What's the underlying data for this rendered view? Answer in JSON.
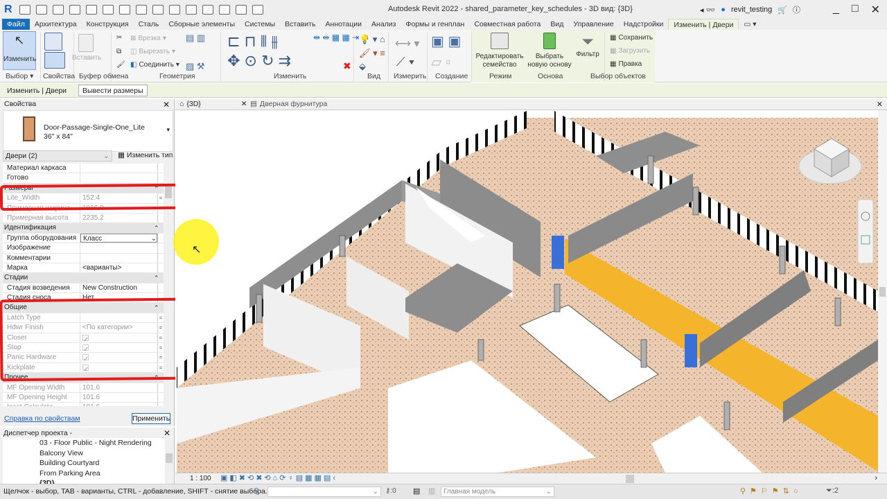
{
  "titlebar": {
    "title": "Autodesk Revit 2022 - shared_parameter_key_schedules - 3D вид: {3D}",
    "user": "revit_testing",
    "app_logo": "R"
  },
  "tabs": [
    "Файл",
    "Архитектура",
    "Конструкция",
    "Сталь",
    "Сборные элементы",
    "Системы",
    "Вставить",
    "Аннотации",
    "Анализ",
    "Формы и генплан",
    "Совместная работа",
    "Вид",
    "Управление",
    "Надстройки",
    "Изменить | Двери"
  ],
  "active_tab": "Изменить | Двери",
  "ribbon": {
    "modify": "Изменить",
    "paste": "Вставить",
    "cut_geom": "Врезка",
    "cut": "Вырезать",
    "join": "Соединить",
    "edit_family": "Редактировать семейство",
    "pick_host": "Выбрать новую основу",
    "filter": "Фильтр",
    "save": "Сохранить",
    "load": "Загрузить",
    "edit": "Правка",
    "panels": [
      "Выбор",
      "Свойства",
      "Буфер обмена",
      "Геометрия",
      "Изменить",
      "Вид",
      "Измерить",
      "Создание",
      "Режим",
      "Основа",
      "Выбор объектов"
    ]
  },
  "context_bar": {
    "label": "Изменить | Двери",
    "button": "Вывести размеры"
  },
  "properties": {
    "title": "Свойства",
    "type_name": "Door-Passage-Single-One_Lite",
    "type_size": "36\" x 84\"",
    "category": "Двери (2)",
    "edit_type": "Изменить тип",
    "rows": [
      {
        "k": "Материал каркаса",
        "v": ""
      },
      {
        "k": "Готово",
        "v": ""
      },
      {
        "group": "Размеры"
      },
      {
        "k": "Lite_Width",
        "v": "152.4",
        "dis": true,
        "eq": true
      },
      {
        "k": "Примерная ширина",
        "v": "1016.0",
        "dis": true
      },
      {
        "k": "Примерная высота",
        "v": "2235.2",
        "dis": true
      },
      {
        "group": "Идентификация"
      },
      {
        "k": "Группа оборудования",
        "v": "Класс",
        "select": true
      },
      {
        "k": "Изображение",
        "v": ""
      },
      {
        "k": "Комментарии",
        "v": ""
      },
      {
        "k": "Марка",
        "v": "<варианты>"
      },
      {
        "group": "Стадии"
      },
      {
        "k": "Стадия возведения",
        "v": "New Construction"
      },
      {
        "k": "Стадия сноса",
        "v": "Нет"
      },
      {
        "group": "Общие"
      },
      {
        "k": "Latch Type",
        "v": "",
        "dis": true,
        "eq": true
      },
      {
        "k": "Hdwr Finish",
        "v": "<По категории>",
        "dis": true,
        "eq": true
      },
      {
        "k": "Closer",
        "v": "",
        "check": true,
        "dis": true,
        "eq": true
      },
      {
        "k": "Stop",
        "v": "",
        "check": true,
        "dis": true,
        "eq": true
      },
      {
        "k": "Panic Hardware",
        "v": "",
        "check": true,
        "dis": true,
        "eq": true
      },
      {
        "k": "Kickplate",
        "v": "",
        "check": true,
        "dis": true,
        "eq": true
      },
      {
        "group": "Прочее"
      },
      {
        "k": "MF Opening Width",
        "v": "101.6",
        "dis": true
      },
      {
        "k": "MF Opening Height",
        "v": "101.6",
        "dis": true
      },
      {
        "k": "Inset Calculate",
        "v": "101.6",
        "dis": true
      }
    ],
    "help": "Справка по свойствам",
    "apply": "Применить"
  },
  "browser": {
    "title": "Диспетчер проекта - shared_parameter_key_sched...",
    "items": [
      "03 - Floor Public - Night Rendering",
      "Balcony View",
      "Building Courtyard",
      "From Parking Area",
      "{3D}"
    ]
  },
  "view_tabs": [
    {
      "label": "{3D}",
      "active": true
    },
    {
      "label": "Дверная фурнитура",
      "active": false
    }
  ],
  "view_bar": {
    "scale": "1 : 100"
  },
  "statusbar": {
    "hint": "Щелчок - выбор, TAB - варианты, CTRL - добавление, SHIFT - снятие выбора.",
    "workset_count": ":0",
    "model": "Главная модель",
    "filter_count": ":2"
  },
  "colors": {
    "file_tab": "#1b6fb8",
    "context_bg": "#eef3e2",
    "highlight": "#e21b1b",
    "floor": "#e9cdb5",
    "wall": "#8c8c8c",
    "yellow_wall": "#f4b52c",
    "door_selected": "#3a6fd8"
  }
}
